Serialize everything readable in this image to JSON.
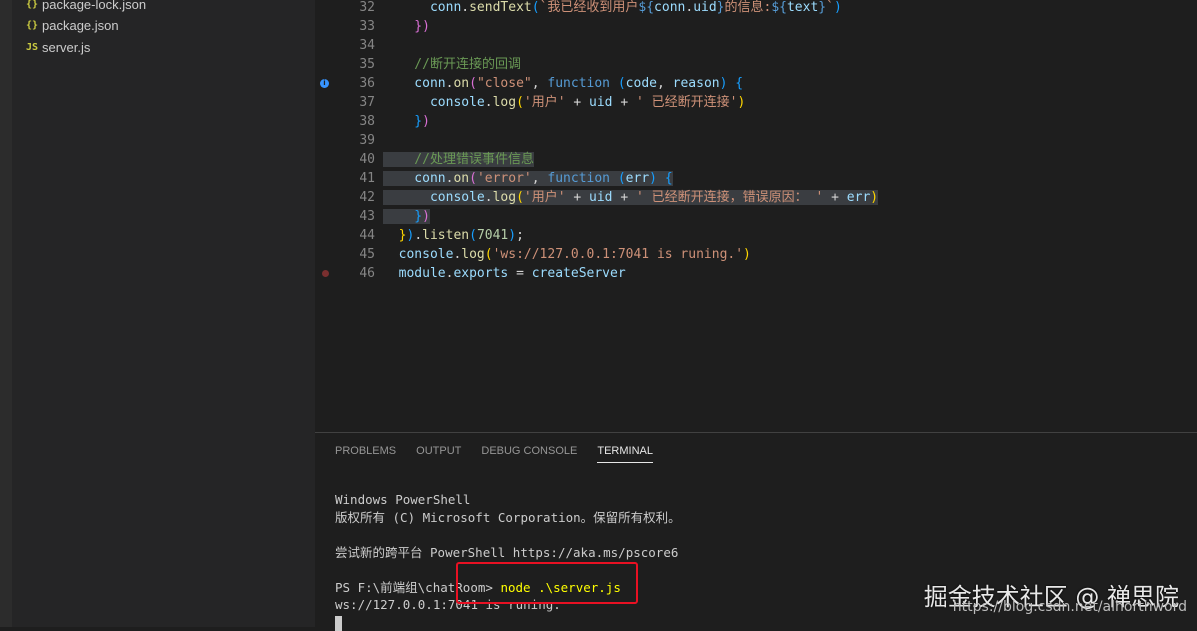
{
  "explorer": {
    "files": [
      {
        "icon": "{}",
        "type": "json",
        "name": "package-lock.json"
      },
      {
        "icon": "{}",
        "type": "json",
        "name": "package.json"
      },
      {
        "icon": "JS",
        "type": "js",
        "name": "server.js"
      }
    ]
  },
  "editor": {
    "lines": [
      {
        "n": "32",
        "tokens": [
          [
            "c-var",
            "      conn"
          ],
          [
            "",
            "."
          ],
          [
            "c-fn",
            "sendText"
          ],
          [
            "c-b",
            "("
          ],
          [
            "c-str",
            "`我已经收到用户"
          ],
          [
            "c-kw",
            "${"
          ],
          [
            "c-var",
            "conn"
          ],
          [
            "",
            "."
          ],
          [
            "c-var",
            "uid"
          ],
          [
            "c-kw",
            "}"
          ],
          [
            "c-str",
            "的信息:"
          ],
          [
            "c-kw",
            "${"
          ],
          [
            "c-var",
            "text"
          ],
          [
            "c-kw",
            "}"
          ],
          [
            "c-str",
            "`"
          ],
          [
            "c-b",
            ")"
          ]
        ]
      },
      {
        "n": "33",
        "tokens": [
          [
            "c-p",
            "    })"
          ]
        ]
      },
      {
        "n": "34",
        "tokens": []
      },
      {
        "n": "35",
        "tokens": [
          [
            "c-cm",
            "    //断开连接的回调"
          ]
        ]
      },
      {
        "n": "36",
        "marker": "info",
        "tokens": [
          [
            "c-var",
            "    conn"
          ],
          [
            "",
            "."
          ],
          [
            "c-fn",
            "on"
          ],
          [
            "c-p",
            "("
          ],
          [
            "c-str",
            "\"close\""
          ],
          [
            "",
            ", "
          ],
          [
            "c-kw",
            "function "
          ],
          [
            "c-b",
            "("
          ],
          [
            "c-var",
            "code"
          ],
          [
            "",
            ", "
          ],
          [
            "c-var",
            "reason"
          ],
          [
            "c-b",
            ")"
          ],
          [
            "",
            " "
          ],
          [
            "c-b",
            "{"
          ]
        ]
      },
      {
        "n": "37",
        "tokens": [
          [
            "c-var",
            "      console"
          ],
          [
            "",
            "."
          ],
          [
            "c-fn",
            "log"
          ],
          [
            "c-y",
            "("
          ],
          [
            "c-str",
            "'用户'"
          ],
          [
            "",
            " + "
          ],
          [
            "c-var",
            "uid"
          ],
          [
            "",
            " + "
          ],
          [
            "c-str",
            "' 已经断开连接'"
          ],
          [
            "c-y",
            ")"
          ]
        ]
      },
      {
        "n": "38",
        "tokens": [
          [
            "c-b",
            "    }"
          ],
          [
            "c-p",
            ")"
          ]
        ]
      },
      {
        "n": "39",
        "tokens": []
      },
      {
        "n": "40",
        "hl": true,
        "tokens": [
          [
            "c-cm",
            "    //处理错误事件信息"
          ]
        ]
      },
      {
        "n": "41",
        "hl": true,
        "tokens": [
          [
            "c-var",
            "    conn"
          ],
          [
            "",
            "."
          ],
          [
            "c-fn",
            "on"
          ],
          [
            "c-p",
            "("
          ],
          [
            "c-str",
            "'error'"
          ],
          [
            "",
            ", "
          ],
          [
            "c-kw",
            "function "
          ],
          [
            "c-b",
            "("
          ],
          [
            "c-var",
            "err"
          ],
          [
            "c-b",
            ")"
          ],
          [
            "",
            " "
          ],
          [
            "c-b",
            "{"
          ]
        ]
      },
      {
        "n": "42",
        "hl": true,
        "tokens": [
          [
            "c-var",
            "      console"
          ],
          [
            "",
            "."
          ],
          [
            "c-fn",
            "log"
          ],
          [
            "c-y",
            "("
          ],
          [
            "c-str",
            "'用户'"
          ],
          [
            "",
            " + "
          ],
          [
            "c-var",
            "uid"
          ],
          [
            "",
            " + "
          ],
          [
            "c-str",
            "' 已经断开连接，错误原因： '"
          ],
          [
            "",
            " + "
          ],
          [
            "c-var",
            "err"
          ],
          [
            "c-y",
            ")"
          ]
        ]
      },
      {
        "n": "43",
        "hl": true,
        "tokens": [
          [
            "c-b",
            "    }"
          ],
          [
            "c-p",
            ")"
          ]
        ]
      },
      {
        "n": "44",
        "tokens": [
          [
            "c-y",
            "  }"
          ],
          [
            "c-b",
            ")"
          ],
          [
            "",
            "."
          ],
          [
            "c-fn",
            "listen"
          ],
          [
            "c-b",
            "("
          ],
          [
            "c-num",
            "7041"
          ],
          [
            "c-b",
            ")"
          ],
          [
            "",
            ";"
          ]
        ]
      },
      {
        "n": "45",
        "tokens": [
          [
            "c-var",
            "  console"
          ],
          [
            "",
            "."
          ],
          [
            "c-fn",
            "log"
          ],
          [
            "c-y",
            "("
          ],
          [
            "c-str",
            "'ws://127.0.0.1:7041 is runing.'"
          ],
          [
            "c-y",
            ")"
          ]
        ]
      },
      {
        "n": "46",
        "marker": "breakpoint",
        "tokens": [
          [
            "c-var",
            "  module"
          ],
          [
            "",
            "."
          ],
          [
            "c-var",
            "exports"
          ],
          [
            "",
            " = "
          ],
          [
            "c-var",
            "createServer"
          ]
        ]
      }
    ]
  },
  "panel": {
    "tabs": [
      {
        "label": "PROBLEMS",
        "active": false
      },
      {
        "label": "OUTPUT",
        "active": false
      },
      {
        "label": "DEBUG CONSOLE",
        "active": false
      },
      {
        "label": "TERMINAL",
        "active": true
      }
    ],
    "terminal": {
      "lines": [
        "",
        "Windows PowerShell",
        "版权所有 (C) Microsoft Corporation。保留所有权利。",
        "",
        "尝试新的跨平台 PowerShell https://aka.ms/pscore6",
        "",
        "PS F:\\前端组\\chatRoom> ",
        "ws://127.0.0.1:7041 is runing."
      ],
      "command": "node .\\server.js"
    }
  },
  "watermark": {
    "main": "掘金技术社区 @ 禅思院",
    "sub": "https://blog.csdn.net/alhorthword"
  },
  "colors": {
    "highlight_box": "#e81123",
    "editor_bg": "#1e1e1e",
    "sidebar_bg": "#252526"
  }
}
